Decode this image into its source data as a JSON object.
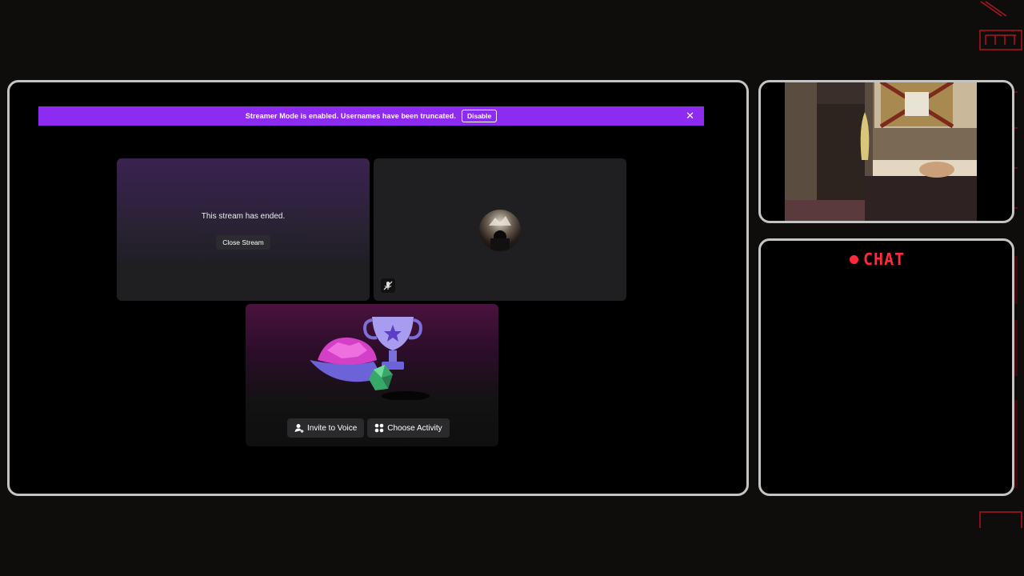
{
  "banner": {
    "message": "Streamer Mode is enabled. Usernames have been truncated.",
    "disable_label": "Disable",
    "close_glyph": "✕",
    "color": "#8d2cf0"
  },
  "stream_tile": {
    "ended_text": "This stream has ended.",
    "close_label": "Close Stream"
  },
  "user_tile": {
    "muted_icon": "mic-muted-icon"
  },
  "activity_tile": {
    "invite_label": "Invite to Voice",
    "choose_label": "Choose Activity"
  },
  "chat_panel": {
    "title": "CHAT",
    "accent": "#ff2a3d"
  }
}
